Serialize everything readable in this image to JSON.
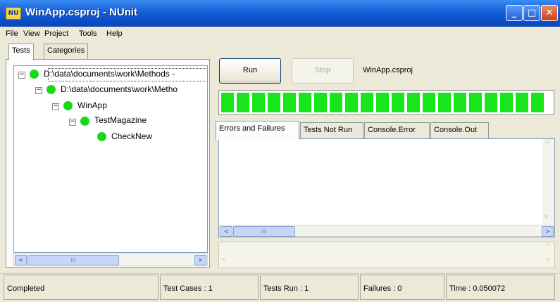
{
  "window": {
    "title": "WinApp.csproj - NUnit",
    "icon_label": "NU",
    "minimize_glyph": "_",
    "maximize_glyph": "□",
    "close_glyph": "✕"
  },
  "menu": {
    "items": [
      "File",
      "View",
      "Project",
      "Tools",
      "Help"
    ]
  },
  "left_tabs": [
    "Tests",
    "Categories"
  ],
  "tree": {
    "nodes": [
      {
        "label": "D:\\data\\documents\\work\\Methods -",
        "status": "passed"
      },
      {
        "label": "D:\\data\\documents\\work\\Metho",
        "status": "passed"
      },
      {
        "label": "WinApp",
        "status": "passed"
      },
      {
        "label": "TestMagazine",
        "status": "passed"
      },
      {
        "label": "CheckNew",
        "status": "passed"
      }
    ],
    "expander_glyph": "−"
  },
  "toolbar": {
    "run_label": "Run",
    "stop_label": "Stop",
    "project_name": "WinApp.csproj"
  },
  "progress": {
    "value": 1.0,
    "color": "#19e51b"
  },
  "result_tabs": [
    "Errors and Failures",
    "Tests Not Run",
    "Console.Error",
    "Console.Out"
  ],
  "scroll_glyphs": {
    "left": "<",
    "right": ">",
    "up": "^",
    "down": "v",
    "grip": "III"
  },
  "status": {
    "state": "Completed",
    "test_cases": "Test Cases : 1",
    "tests_run": "Tests Run : 1",
    "failures": "Failures : 0",
    "time": "Time : 0.050072"
  },
  "colors": {
    "passed": "#18d818",
    "titlebar": "#0a4fc9"
  }
}
